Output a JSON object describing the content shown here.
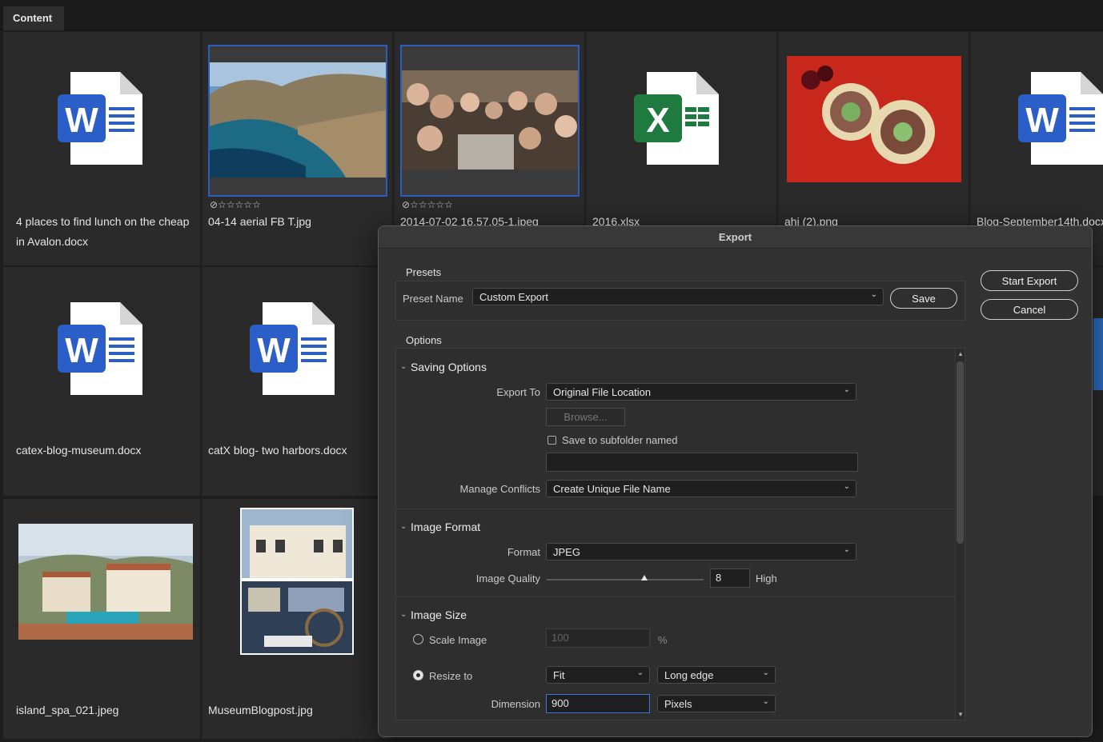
{
  "tabs": {
    "content_label": "Content"
  },
  "grid": {
    "items": [
      {
        "name": "4 places to find lunch on the cheap in Avalon.docx",
        "type": "word"
      },
      {
        "name": "04-14 aerial FB T.jpg",
        "type": "photo-aerial",
        "rating": "⊘☆☆☆☆☆"
      },
      {
        "name": "2014-07-02 16.57.05-1.jpeg",
        "type": "photo-group",
        "rating": "⊘☆☆☆☆☆"
      },
      {
        "name": "2016.xlsx",
        "type": "excel"
      },
      {
        "name": "ahi (2).png",
        "type": "photo-food"
      },
      {
        "name": "Blog-September14th.docx",
        "type": "word"
      },
      {
        "name": "catex-blog-museum.docx",
        "type": "word"
      },
      {
        "name": "catX blog- two harbors.docx",
        "type": "word"
      },
      {
        "name": "island_spa_021.jpeg",
        "type": "photo-spa"
      },
      {
        "name": "MuseumBlogpost.jpg",
        "type": "photo-museum"
      }
    ]
  },
  "dialog": {
    "title": "Export",
    "start_export": "Start Export",
    "cancel": "Cancel",
    "presets": {
      "heading": "Presets",
      "preset_name_label": "Preset Name",
      "preset_name_value": "Custom Export",
      "save": "Save"
    },
    "options": {
      "heading": "Options",
      "saving": {
        "heading": "Saving Options",
        "export_to_label": "Export To",
        "export_to_value": "Original File Location",
        "browse": "Browse...",
        "subfolder_label": "Save to subfolder named",
        "subfolder_value": "",
        "conflicts_label": "Manage Conflicts",
        "conflicts_value": "Create Unique File Name"
      },
      "format": {
        "heading": "Image Format",
        "format_label": "Format",
        "format_value": "JPEG",
        "quality_label": "Image Quality",
        "quality_value": "8",
        "quality_word": "High",
        "quality_fraction": 0.62
      },
      "size": {
        "heading": "Image Size",
        "scale_label": "Scale Image",
        "scale_value": "100",
        "scale_unit": "%",
        "resize_label": "Resize to",
        "resize_mode": "Fit",
        "resize_edge": "Long edge",
        "dimension_label": "Dimension",
        "dimension_value": "900",
        "dimension_unit": "Pixels"
      }
    }
  },
  "icons": {
    "word_letter": "W",
    "excel_letter": "X"
  },
  "colors": {
    "word_blue": "#2b5fc7",
    "excel_green": "#1f7a3f",
    "selection": "#2e5db8"
  }
}
